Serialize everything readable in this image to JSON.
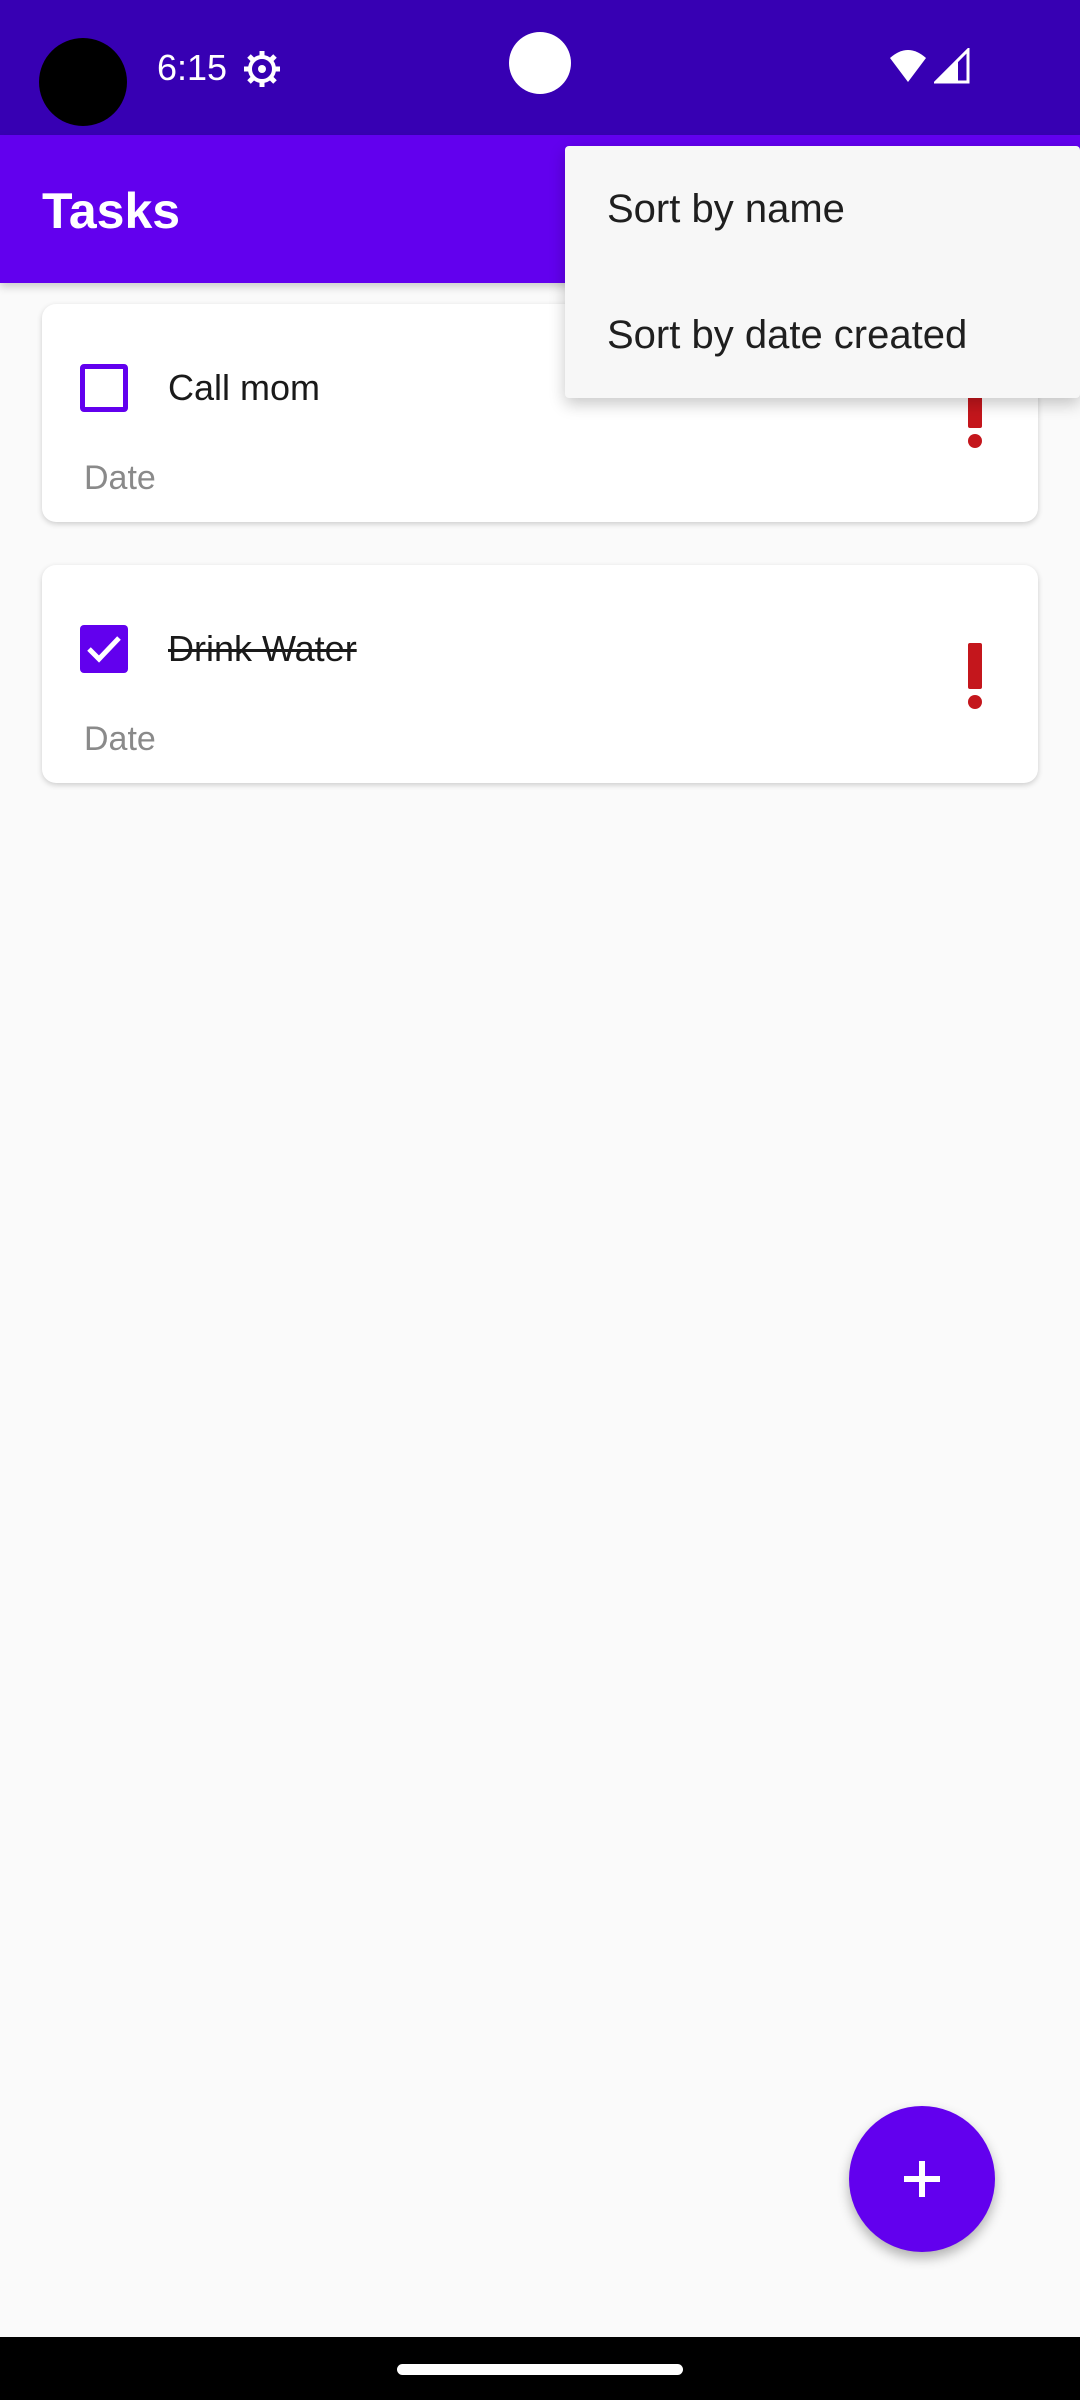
{
  "status_bar": {
    "time": "6:15",
    "icons": [
      "camera-cutout",
      "settings-gear-icon",
      "wifi-icon",
      "signal-icon"
    ]
  },
  "app_bar": {
    "title": "Tasks"
  },
  "menu": {
    "items": [
      {
        "label": "Sort by name"
      },
      {
        "label": "Sort by date created"
      }
    ]
  },
  "tasks": [
    {
      "title": "Call mom",
      "date": "Date",
      "completed": false,
      "priority_icon": "exclamation-icon"
    },
    {
      "title": "Drink Water",
      "date": "Date",
      "completed": true,
      "priority_icon": "exclamation-icon"
    }
  ],
  "fab": {
    "icon": "plus-icon"
  },
  "colors": {
    "primary": "#6200ee",
    "primary_dark": "#3700b3",
    "priority": "#c4161c",
    "background": "#fafafa"
  }
}
